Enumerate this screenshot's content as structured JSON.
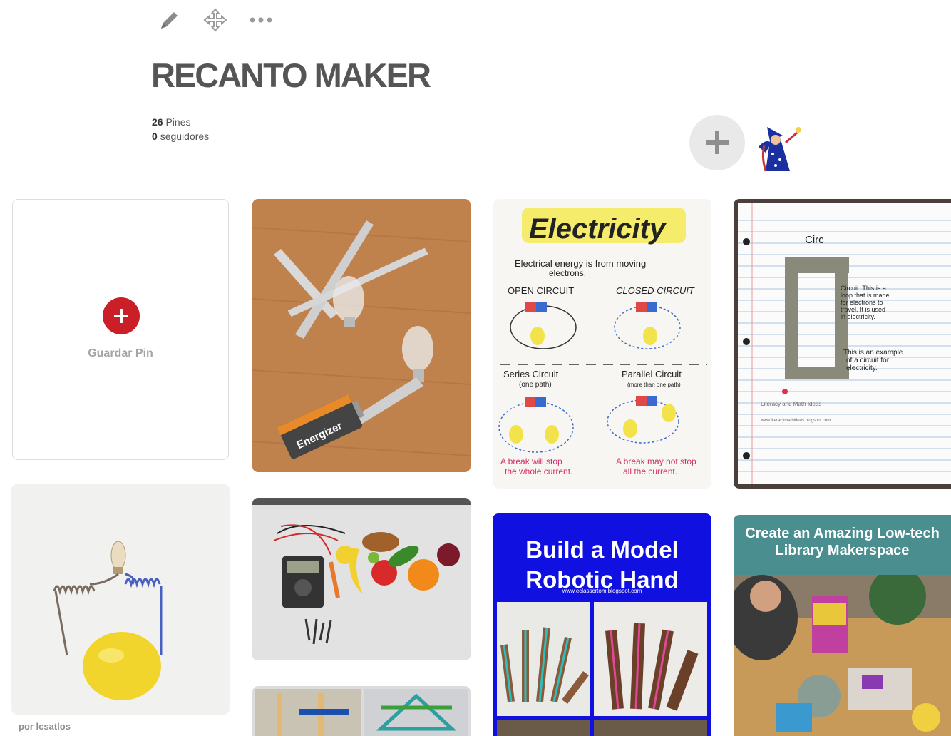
{
  "toolbar": {
    "icons": [
      "pencil-icon",
      "move-icon",
      "more-icon"
    ]
  },
  "board": {
    "title": "RECANTO MAKER",
    "pins_count": "26",
    "pins_label": "Pines",
    "followers_count": "0",
    "followers_label": "seguidores"
  },
  "save_card": {
    "label": "Guardar Pin"
  },
  "pins": {
    "credit": "por lcsatlos",
    "electricity": {
      "title": "Electricity",
      "line1": "Electrical energy is from moving",
      "line2": "electrons.",
      "open": "OPEN CIRCUIT",
      "closed": "CLOSED CIRCUIT",
      "series": "Series Circuit",
      "series_note": "(one path)",
      "parallel": "Parallel Circuit",
      "parallel_note": "(more than one path)",
      "break1": "A break will stop",
      "break2": "the whole current.",
      "break3": "A break may not stop",
      "break4": "all the current."
    },
    "notebook": {
      "heading": "Circ",
      "note1": "Circuit: This is a",
      "note2": "loop that is made",
      "note3": "for electrons to",
      "note4": "travel. It is used",
      "note5": "in electricity.",
      "note6": "This is an example",
      "note7": "of a circuit for",
      "note8": "electricity.",
      "credit1": "Literacy and Math Ideas",
      "credit2": "www.literacymathideas.blogspot.com"
    },
    "robotic_hand": {
      "title1": "Build a Model",
      "title2": "Robotic Hand",
      "site": "www.eclasscrtom.blogspot.com"
    },
    "makerspace": {
      "title1": "Create an Amazing Low-tech",
      "title2": "Library Makerspace"
    },
    "battery": {
      "brand": "Energizer"
    }
  },
  "colors": {
    "red": "#cb1f27",
    "blue": "#1010e0",
    "teal": "#4a8e8f"
  }
}
